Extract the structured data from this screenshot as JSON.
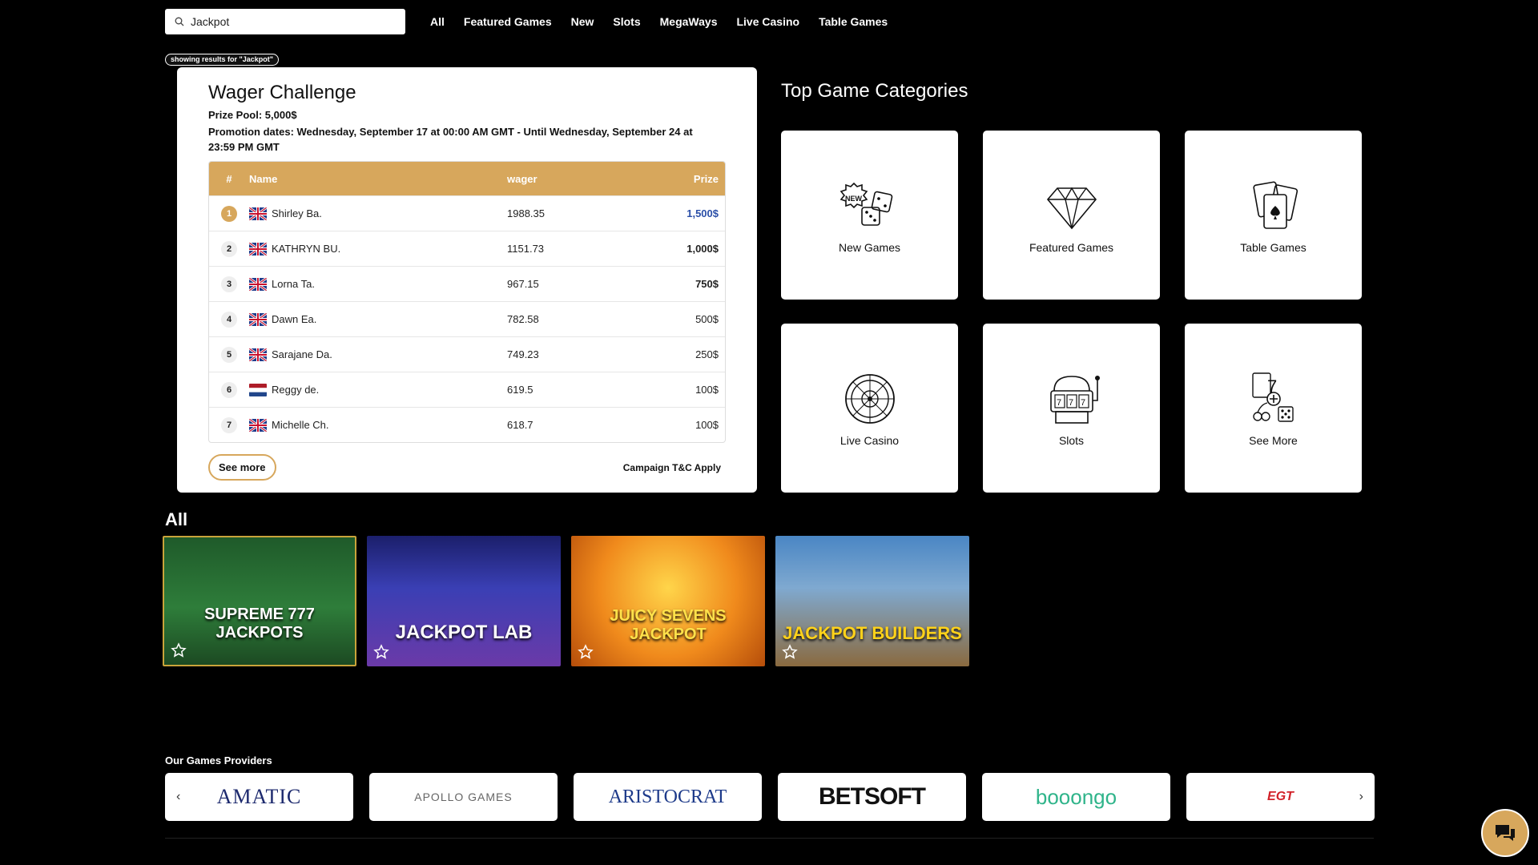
{
  "search": {
    "value": "Jackpot"
  },
  "nav": [
    "All",
    "Featured Games",
    "New",
    "Slots",
    "MegaWays",
    "Live Casino",
    "Table Games"
  ],
  "results_pill": "showing results for \"Jackpot\"",
  "wager": {
    "title": "Wager Challenge",
    "prize_pool": "Prize Pool: 5,000$",
    "dates": "Promotion dates: Wednesday, September 17 at 00:00 AM GMT - Until Wednesday, September 24 at 23:59 PM GMT",
    "columns": {
      "rank": "#",
      "name": "Name",
      "wager": "wager",
      "prize": "Prize"
    },
    "rows": [
      {
        "rank": "1",
        "name": "Shirley Ba.",
        "wager": "1988.35",
        "prize": "1,500$",
        "flag": "uk"
      },
      {
        "rank": "2",
        "name": "KATHRYN BU.",
        "wager": "1151.73",
        "prize": "1,000$",
        "flag": "uk"
      },
      {
        "rank": "3",
        "name": "Lorna Ta.",
        "wager": "967.15",
        "prize": "750$",
        "flag": "uk"
      },
      {
        "rank": "4",
        "name": "Dawn Ea.",
        "wager": "782.58",
        "prize": "500$",
        "flag": "uk"
      },
      {
        "rank": "5",
        "name": "Sarajane Da.",
        "wager": "749.23",
        "prize": "250$",
        "flag": "uk"
      },
      {
        "rank": "6",
        "name": "Reggy de.",
        "wager": "619.5",
        "prize": "100$",
        "flag": "nl"
      },
      {
        "rank": "7",
        "name": "Michelle Ch.",
        "wager": "618.7",
        "prize": "100$",
        "flag": "uk"
      }
    ],
    "see_more": "See more",
    "tc": "Campaign T&C Apply"
  },
  "categories": {
    "title": "Top Game Categories",
    "items": [
      {
        "label": "New Games",
        "icon": "new-dice-icon"
      },
      {
        "label": "Featured Games",
        "icon": "diamond-icon"
      },
      {
        "label": "Table Games",
        "icon": "playing-cards-icon"
      },
      {
        "label": "Live Casino",
        "icon": "roulette-icon"
      },
      {
        "label": "Slots",
        "icon": "slot-machine-icon"
      },
      {
        "label": "See More",
        "icon": "games-collection-icon"
      }
    ]
  },
  "all": {
    "title": "All",
    "games": [
      {
        "title": "SUPREME 777 JACKPOTS"
      },
      {
        "title": "JACKPOT LAB"
      },
      {
        "title": "JUICY SEVENS JACKPOT"
      },
      {
        "title": "JACKPOT BUILDERS"
      }
    ]
  },
  "providers": {
    "title": "Our Games Providers",
    "items": [
      "AMATIC",
      "APOLLO GAMES",
      "ARISTOCRAT",
      "BETSOFT",
      "booongo",
      "EGT"
    ]
  },
  "colors": {
    "accent": "#d7a75c",
    "background": "#000000",
    "card": "#ffffff"
  }
}
